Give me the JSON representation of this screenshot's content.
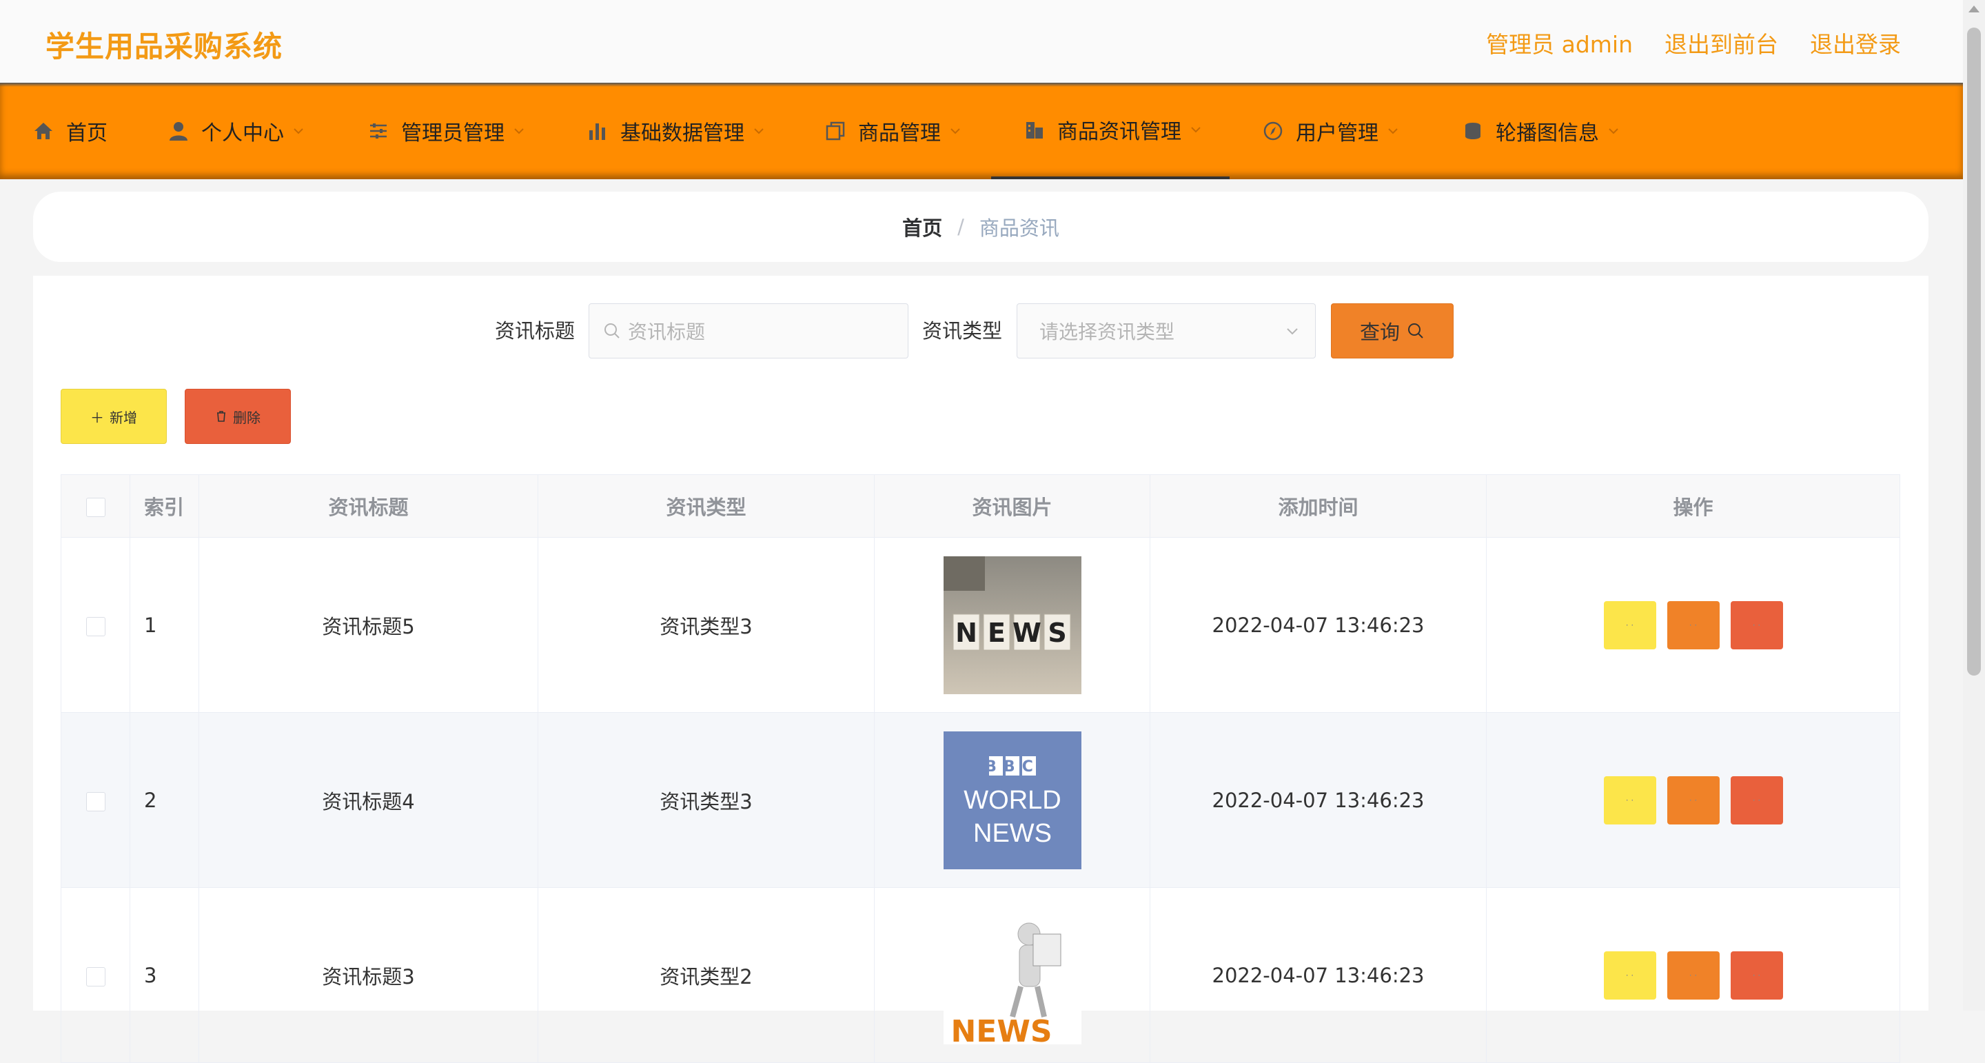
{
  "header": {
    "brand": "学生用品采购系统",
    "user_label": "管理员 admin",
    "front_label": "退出到前台",
    "logout_label": "退出登录"
  },
  "nav": {
    "items": [
      {
        "label": "首页",
        "icon": "home-icon"
      },
      {
        "label": "个人中心",
        "icon": "user-icon"
      },
      {
        "label": "管理员管理",
        "icon": "sliders-icon"
      },
      {
        "label": "基础数据管理",
        "icon": "bar-chart-icon"
      },
      {
        "label": "商品管理",
        "icon": "copy-icon"
      },
      {
        "label": "商品资讯管理",
        "icon": "building-icon"
      },
      {
        "label": "用户管理",
        "icon": "compass-icon"
      },
      {
        "label": "轮播图信息",
        "icon": "cylinder-icon"
      }
    ],
    "active_index": 5
  },
  "breadcrumb": {
    "home": "首页",
    "separator": "/",
    "current": "商品资讯"
  },
  "search": {
    "title_label": "资讯标题",
    "title_placeholder": "资讯标题",
    "type_label": "资讯类型",
    "type_placeholder": "请选择资讯类型",
    "query_label": "查询"
  },
  "actions": {
    "add_label": "新增",
    "delete_label": "删除"
  },
  "table": {
    "columns": [
      "索引",
      "资讯标题",
      "资讯类型",
      "资讯图片",
      "添加时间",
      "操作"
    ],
    "rows": [
      {
        "index": "1",
        "title": "资讯标题5",
        "type": "资讯类型3",
        "image": "news-blocks-image",
        "time": "2022-04-07 13:46:23"
      },
      {
        "index": "2",
        "title": "资讯标题4",
        "type": "资讯类型3",
        "image": "bbc-world-news-image",
        "time": "2022-04-07 13:46:23"
      },
      {
        "index": "3",
        "title": "资讯标题3",
        "type": "资讯类型2",
        "image": "news-figure-image",
        "time": "2022-04-07 13:46:23"
      }
    ],
    "op_labels": [
      "· ·",
      "· ·",
      "· ·"
    ]
  },
  "images": {
    "bbc": {
      "badge": "BBC",
      "line1": "WORLD",
      "line2": "NEWS"
    },
    "news": "NEWS"
  },
  "colors": {
    "brand": "#f39a15",
    "nav_bg": "#ff8c00",
    "btn_yellow": "#fce54a",
    "btn_orange": "#f08228",
    "btn_red": "#e9603c"
  }
}
